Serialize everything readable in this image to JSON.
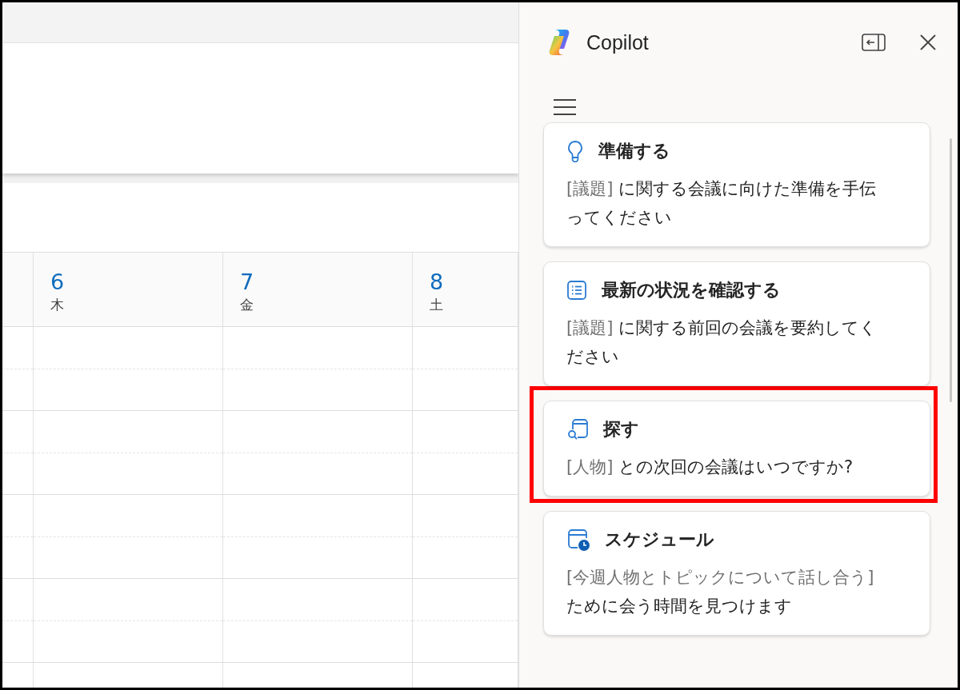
{
  "calendar": {
    "days": [
      {
        "number": "6",
        "weekday": "木"
      },
      {
        "number": "7",
        "weekday": "金"
      },
      {
        "number": "8",
        "weekday": "土"
      }
    ]
  },
  "copilot": {
    "title": "Copilot",
    "prompts": [
      {
        "kind": "prepare",
        "title": "準備する",
        "slot": "[議題]",
        "text": " に関する会議に向けた準備を手伝ってください",
        "highlighted": false
      },
      {
        "kind": "summary",
        "title": "最新の状況を確認する",
        "slot": "[議題]",
        "text": " に関する前回の会議を要約してください",
        "highlighted": false
      },
      {
        "kind": "find",
        "title": "探す",
        "slot": "[人物]",
        "text": " との次回の会議はいつですか?",
        "highlighted": true
      },
      {
        "kind": "schedule",
        "title": "スケジュール",
        "slot": "[今週人物とトピックについて話し合う]",
        "text": " ために会う時間を見つけます",
        "highlighted": false
      }
    ]
  }
}
